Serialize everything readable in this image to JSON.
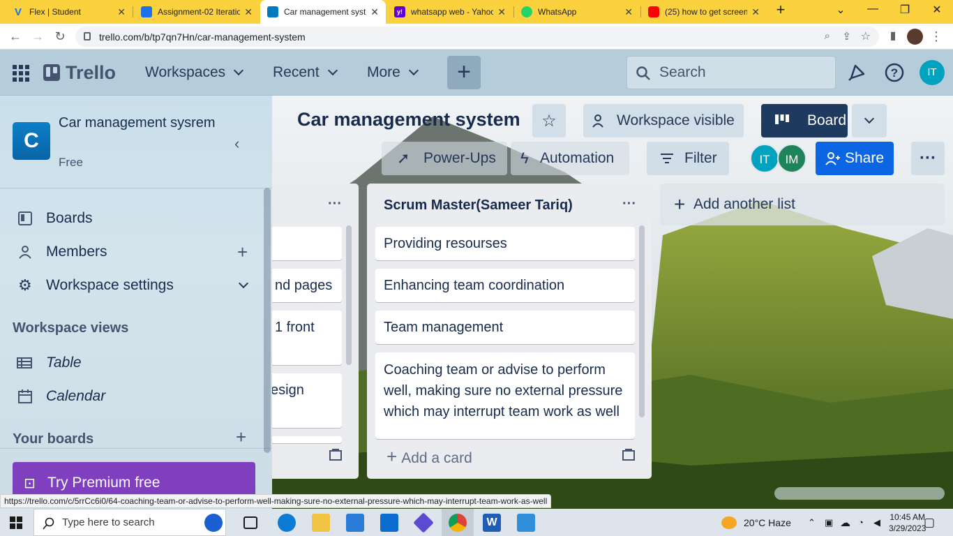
{
  "browser": {
    "tabs": [
      {
        "title": "Flex | Student",
        "fav_color": "#fbd13d",
        "fav_text": "V",
        "active": false
      },
      {
        "title": "Assignment-02 Iteratio",
        "fav_color": "#1a73e8",
        "fav_text": "",
        "active": false
      },
      {
        "title": "Car management syste",
        "fav_color": "#0079bf",
        "fav_text": "",
        "active": true
      },
      {
        "title": "whatsapp web - Yahoo",
        "fav_color": "#6001d2",
        "fav_text": "y!",
        "active": false
      },
      {
        "title": "WhatsApp",
        "fav_color": "#25d366",
        "fav_text": "",
        "active": false
      },
      {
        "title": "(25) how to get screen",
        "fav_color": "#ff0000",
        "fav_text": "",
        "active": false
      }
    ],
    "new_tab": "+",
    "url": "trello.com/b/tp7qn7Hn/car-management-system"
  },
  "header": {
    "logo": "Trello",
    "nav": [
      "Workspaces",
      "Recent",
      "More"
    ],
    "create": "+",
    "search_placeholder": "Search",
    "avatar": "IT"
  },
  "sidebar": {
    "workspace_initial": "C",
    "workspace_name": "Car management sysrem",
    "plan": "Free",
    "items": [
      {
        "label": "Boards",
        "icon": "board-icon"
      },
      {
        "label": "Members",
        "icon": "person-icon"
      },
      {
        "label": "Workspace settings",
        "icon": "gear-icon"
      }
    ],
    "views_heading": "Workspace views",
    "views": [
      {
        "label": "Table",
        "icon": "table-icon"
      },
      {
        "label": "Calendar",
        "icon": "calendar-icon"
      }
    ],
    "boards_heading": "Your boards",
    "premium": "Try Premium free"
  },
  "board": {
    "title": "Car management system",
    "visibility": "Workspace visible",
    "view": "Board",
    "powerups": "Power-Ups",
    "automation": "Automation",
    "filter": "Filter",
    "members": [
      {
        "initials": "IT",
        "color": "#00a3bf"
      },
      {
        "initials": "IM",
        "color": "#1f845a"
      }
    ],
    "share": "Share"
  },
  "lists": [
    {
      "title": "",
      "cards": [
        "",
        "nd pages",
        "1 front",
        "esign"
      ]
    },
    {
      "title": "Scrum Master(Sameer Tariq)",
      "cards": [
        "Providing resourses",
        "Enhancing team coordination",
        "Team management",
        "Coaching team or advise to perform well, making sure no external pressure which may interrupt team work as well"
      ],
      "add_card": "Add a card"
    }
  ],
  "add_list": "Add another list",
  "status_url": "https://trello.com/c/5rrCc6i0/64-coaching-team-or-advise-to-perform-well-making-sure-no-external-pressure-which-may-interrupt-team-work-as-well",
  "taskbar": {
    "search_placeholder": "Type here to search",
    "weather": "20°C  Haze",
    "time": "10:45 AM",
    "date": "3/29/2023"
  }
}
